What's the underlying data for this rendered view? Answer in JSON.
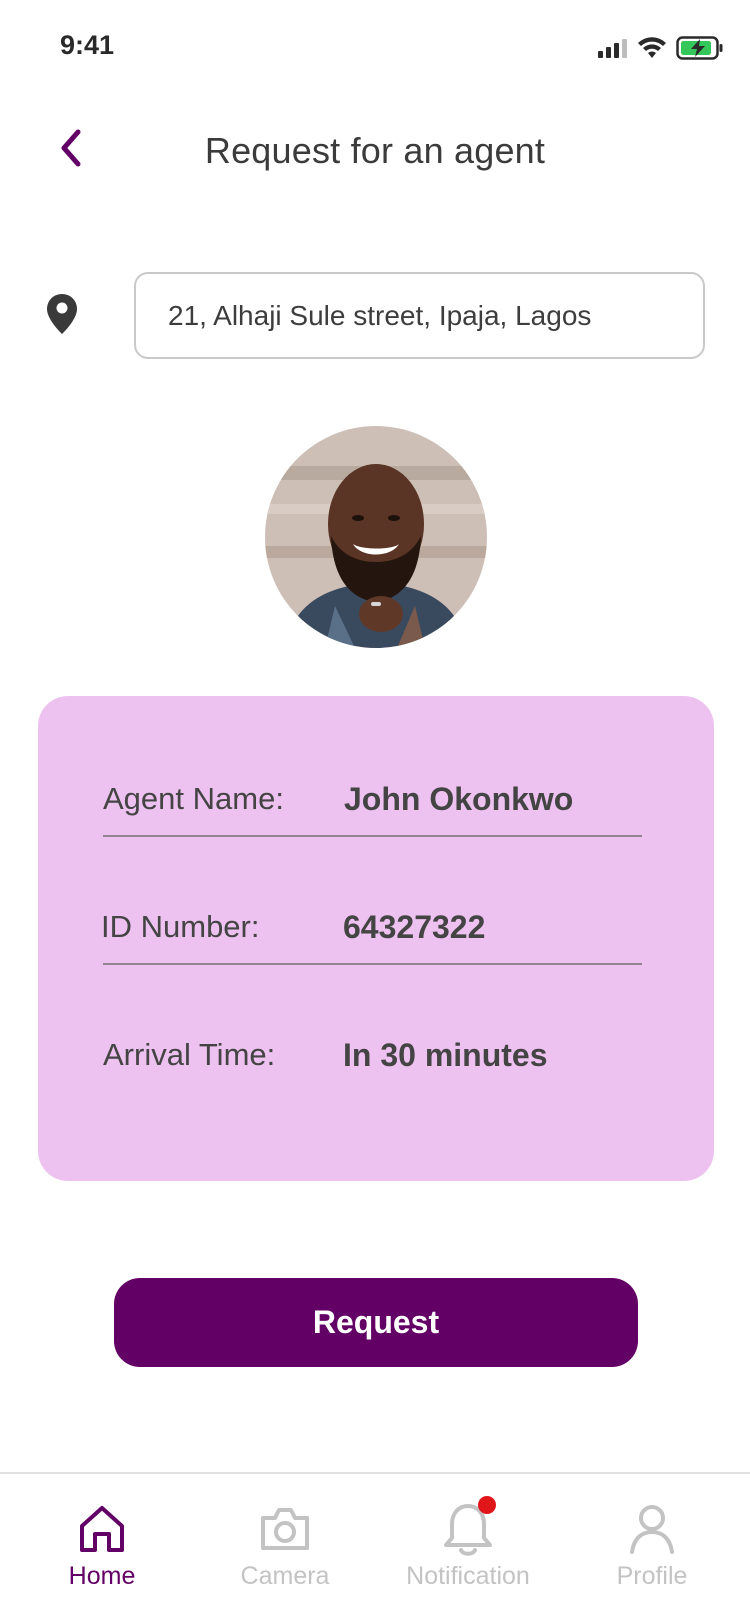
{
  "status_bar": {
    "time": "9:41",
    "icons": [
      "signal-icon",
      "wifi-icon",
      "battery-charging-icon"
    ]
  },
  "header": {
    "back_icon": "chevron-left-icon",
    "title": "Request for an agent"
  },
  "location": {
    "icon": "location-pin-icon",
    "address": "21, Alhaji Sule street, Ipaja, Lagos"
  },
  "agent": {
    "photo_icon": "agent-photo",
    "name_label": "Agent Name:",
    "name": "John Okonkwo",
    "id_label": "ID Number:",
    "id": "64327322",
    "arrival_label": "Arrival Time:",
    "arrival": "In 30 minutes"
  },
  "request_button": "Request",
  "bottom_nav": {
    "home": "Home",
    "camera": "Camera",
    "notification": "Notification",
    "profile": "Profile",
    "active": "home"
  },
  "colors": {
    "brand": "#620066",
    "card_bg": "#eec2f0",
    "badge": "#e0161b",
    "battery": "#34c759"
  }
}
